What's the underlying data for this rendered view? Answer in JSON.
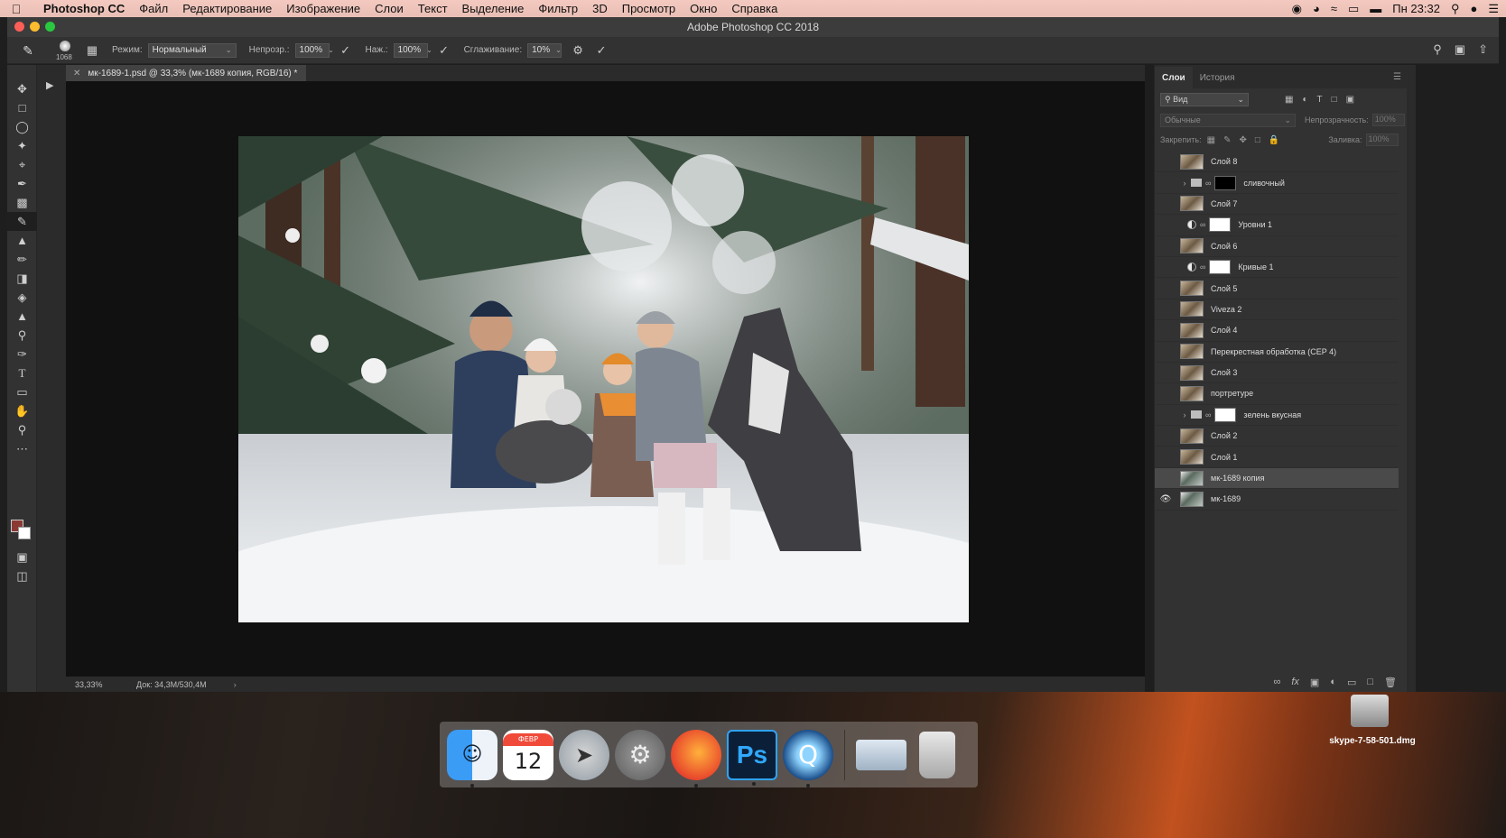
{
  "menubar": {
    "app": "Photoshop CC",
    "items": [
      "Файл",
      "Редактирование",
      "Изображение",
      "Слои",
      "Текст",
      "Выделение",
      "Фильтр",
      "3D",
      "Просмотр",
      "Окно",
      "Справка"
    ],
    "clock": "Пн 23:32"
  },
  "window": {
    "title": "Adobe Photoshop CC 2018"
  },
  "options": {
    "brush_size": "1068",
    "mode_label": "Режим:",
    "mode_value": "Нормальный",
    "opacity_label": "Непрозр.:",
    "opacity_value": "100%",
    "pressure_label": "Наж.:",
    "pressure_value": "100%",
    "smoothing_label": "Сглаживание:",
    "smoothing_value": "10%"
  },
  "document": {
    "tab_title": "мк-1689-1.psd @ 33,3% (мк-1689 копия, RGB/16) *",
    "zoom": "33,33%",
    "doc_size": "Док: 34,3M/530,4M"
  },
  "layers_panel": {
    "tabs": [
      "Слои",
      "История"
    ],
    "filter_placeholder": "Вид",
    "blend_mode": "Обычные",
    "opacity_label": "Непрозрачность:",
    "opacity_value": "100%",
    "lock_label": "Закрепить:",
    "fill_label": "Заливка:",
    "fill_value": "100%",
    "layers": [
      {
        "name": "Слой 8"
      },
      {
        "name": "сливочный"
      },
      {
        "name": "Слой 7"
      },
      {
        "name": "Уровни 1"
      },
      {
        "name": "Слой 6"
      },
      {
        "name": "Кривые 1"
      },
      {
        "name": "Слой 5"
      },
      {
        "name": "Viveza 2"
      },
      {
        "name": "Слой 4"
      },
      {
        "name": "Перекрестная обработка (CEP 4)"
      },
      {
        "name": "Слой 3"
      },
      {
        "name": "портретуре"
      },
      {
        "name": "зелень вкусная"
      },
      {
        "name": "Слой 2"
      },
      {
        "name": "Слой 1"
      },
      {
        "name": "мк-1689 копия"
      },
      {
        "name": "мк-1689"
      }
    ]
  },
  "dock": {
    "calendar_month": "ФЕВР",
    "calendar_day": "12",
    "ps_label": "Ps"
  },
  "desktop": {
    "file_label": "skype-7-58-501.dmg"
  }
}
